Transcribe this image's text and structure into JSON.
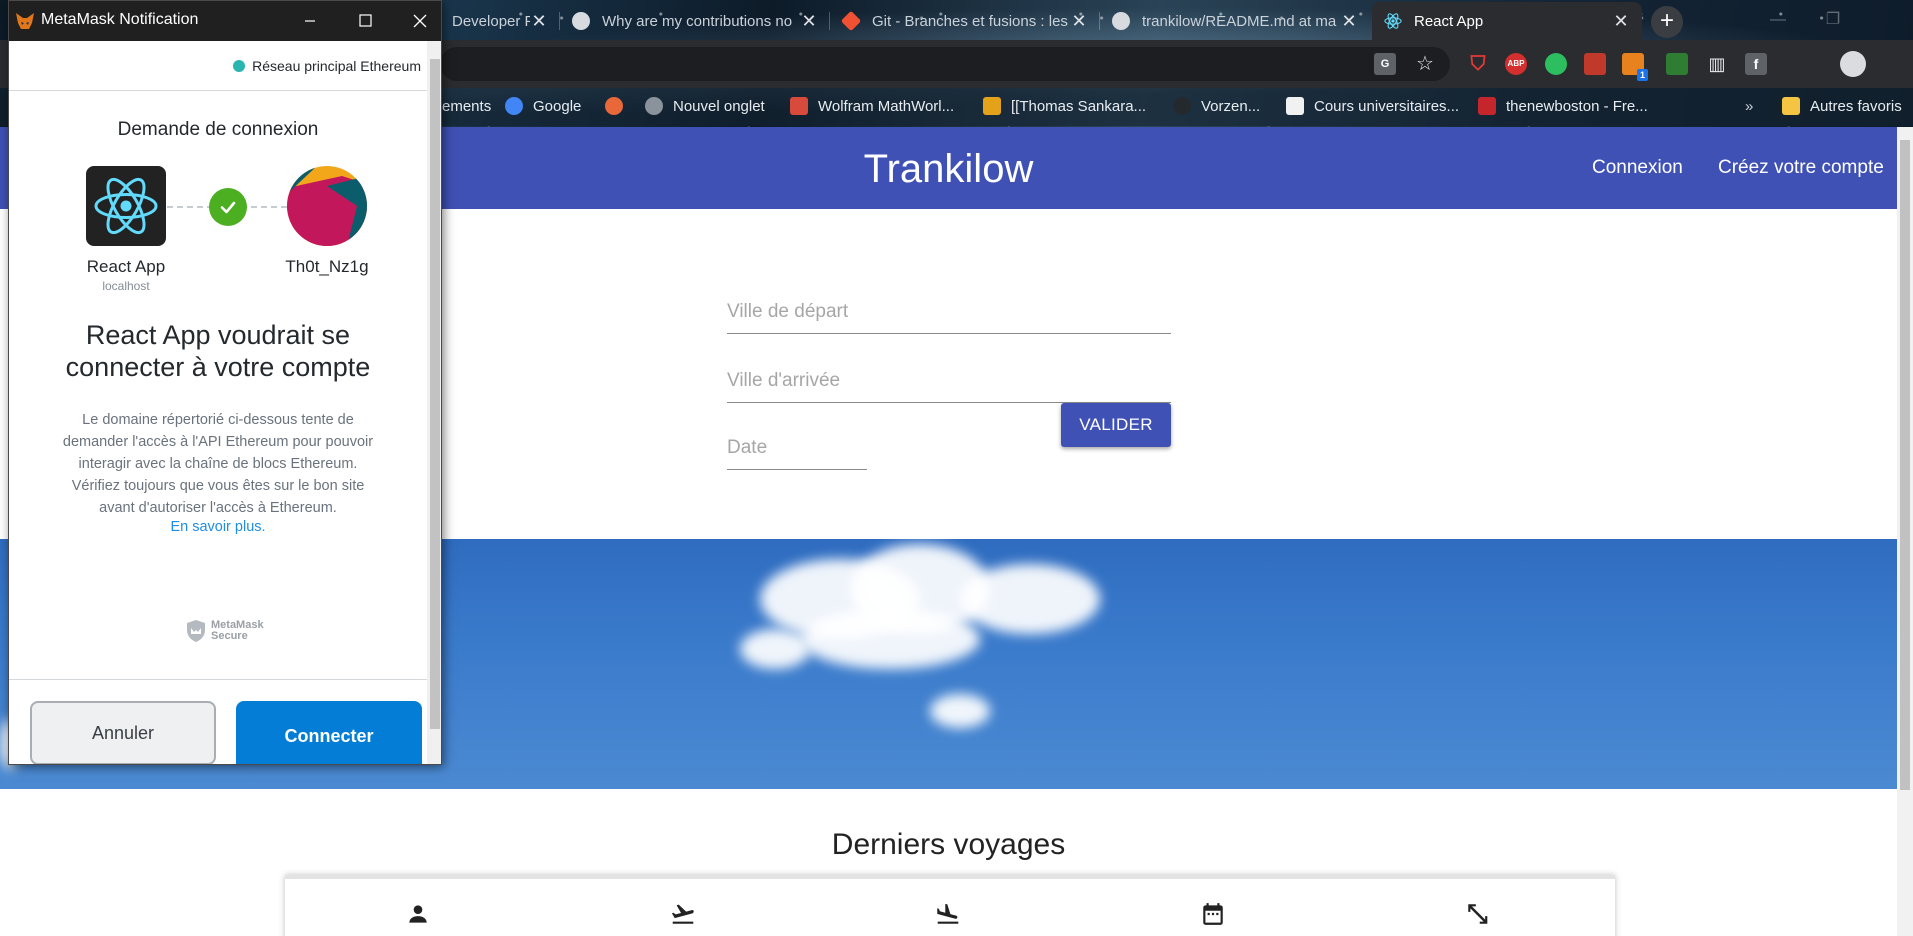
{
  "browser": {
    "tabs": [
      {
        "label": "Developer Pa",
        "favicon_color": "#6f7d8c"
      },
      {
        "label": "Why are my contributions no",
        "favicon_color": "#24292e"
      },
      {
        "label": "Git - Branches et fusions : les",
        "favicon_color": "#f05133"
      },
      {
        "label": "trankilow/README.md at ma",
        "favicon_color": "#24292e"
      },
      {
        "label": "React App",
        "favicon_color": "#61dafb"
      }
    ],
    "tab_close_glyph": "✕",
    "new_tab_glyph": "+",
    "bookmarks": [
      {
        "label": "ements",
        "icon_color": "#7c8792"
      },
      {
        "label": "Google",
        "icon_color": "#4285f4"
      },
      {
        "label": "",
        "icon_color": "#e8683a"
      },
      {
        "label": "Nouvel onglet",
        "icon_color": "#8a939c"
      },
      {
        "label": "Wolfram MathWorl...",
        "icon_color": "#d74a3c"
      },
      {
        "label": "[[Thomas Sankara...",
        "icon_color": "#e3a21a"
      },
      {
        "label": "Vorzen...",
        "icon_color": "#24292e"
      },
      {
        "label": "Cours universitaires...",
        "icon_color": "#1a1a1a"
      },
      {
        "label": "thenewboston - Fre...",
        "icon_color": "#c5262c"
      }
    ],
    "bookmarks_overflow": "»",
    "other_bookmarks": "Autres favoris",
    "extension_labels": {
      "abp": "ABP",
      "ext_badge": "1"
    }
  },
  "page": {
    "title": "Trankilow",
    "nav": {
      "login": "Connexion",
      "signup": "Créez votre compte"
    },
    "form": {
      "departure_placeholder": "Ville de départ",
      "arrival_placeholder": "Ville d'arrivée",
      "date_placeholder": "Date",
      "submit_label": "VALIDER"
    },
    "last_trips_title": "Derniers voyages",
    "columns": [
      "person-icon",
      "departure-icon",
      "arrival-icon",
      "calendar-icon",
      "distance-icon"
    ]
  },
  "metamask": {
    "window_title": "MetaMask Notification",
    "network": "Réseau principal Ethereum",
    "request_title": "Demande de connexion",
    "app_name": "React App",
    "app_host": "localhost",
    "account_name": "Th0t_Nz1g",
    "heading": "React App voudrait se connecter à votre compte",
    "description": "Le domaine répertorié ci-dessous tente de demander l'accès à l'API Ethereum pour pouvoir interagir avec la chaîne de blocs Ethereum. Vérifiez toujours que vous êtes sur le bon site avant d'autoriser l'accès à Ethereum.",
    "learn_more": "En savoir plus.",
    "secure_line1": "MetaMask",
    "secure_line2": "Secure",
    "cancel_label": "Annuler",
    "connect_label": "Connecter"
  },
  "colors": {
    "header_blue": "#3f51b5",
    "metamask_blue": "#037dd6",
    "check_green": "#4caf21",
    "network_teal": "#29b6af"
  }
}
